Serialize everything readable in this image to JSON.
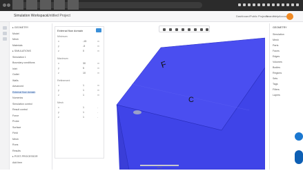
{
  "header": {
    "app_name": "Simulation Workspace",
    "project": "Untitled Project",
    "links": [
      "Dashboard",
      "Public Projects",
      "Search",
      "Help",
      "Account"
    ],
    "accent": "#f08a24"
  },
  "left_tree": {
    "items": [
      {
        "label": "▸ GEOMETRY",
        "sel": false
      },
      {
        "label": "  Model",
        "sel": false
      },
      {
        "label": "  Mesh",
        "sel": false
      },
      {
        "label": "  Materials",
        "sel": false
      },
      {
        "label": "▸ SIMULATIONS",
        "sel": false
      },
      {
        "label": "  Simulation 1",
        "sel": false
      },
      {
        "label": "  Boundary conditions",
        "sel": false
      },
      {
        "label": "  Inlet",
        "sel": false
      },
      {
        "label": "  Outlet",
        "sel": false
      },
      {
        "label": "  Walls",
        "sel": false
      },
      {
        "label": "  Advanced",
        "sel": false
      },
      {
        "label": "  External flow domain",
        "sel": true
      },
      {
        "label": "  Numerics",
        "sel": false
      },
      {
        "label": "  Simulation control",
        "sel": false
      },
      {
        "label": "  Result control",
        "sel": false
      },
      {
        "label": "  Force",
        "sel": false
      },
      {
        "label": "  Probe",
        "sel": false
      },
      {
        "label": "  Surface",
        "sel": false
      },
      {
        "label": "  Field",
        "sel": false
      },
      {
        "label": "  Mesh",
        "sel": false
      },
      {
        "label": "  Runs",
        "sel": false
      },
      {
        "label": "  Results",
        "sel": false
      },
      {
        "label": "▸ POST-PROCESSOR",
        "sel": false
      }
    ],
    "footer": "Add item"
  },
  "side_panel": {
    "title": "External flow domain",
    "sections": [
      {
        "label": "Minimum",
        "fields": [
          {
            "k": "x",
            "v": "-15",
            "u": "m"
          },
          {
            "k": "y",
            "v": "-5",
            "u": "m"
          },
          {
            "k": "z",
            "v": "0",
            "u": "m"
          }
        ]
      },
      {
        "label": "Maximum",
        "fields": [
          {
            "k": "x",
            "v": "30",
            "u": "m"
          },
          {
            "k": "y",
            "v": "5",
            "u": "m"
          },
          {
            "k": "z",
            "v": "10",
            "u": "m"
          }
        ]
      },
      {
        "label": "Refinement",
        "fields": [
          {
            "k": "x",
            "v": "1",
            "u": "m"
          },
          {
            "k": "y",
            "v": "1",
            "u": "m"
          },
          {
            "k": "z",
            "v": "1",
            "u": "m"
          }
        ]
      },
      {
        "label": "Mesh",
        "fields": [
          {
            "k": "x",
            "v": "1",
            "u": "-"
          },
          {
            "k": "y",
            "v": "1",
            "u": "-"
          },
          {
            "k": "z",
            "v": "1",
            "u": "-"
          }
        ]
      }
    ]
  },
  "viewport": {
    "face_label_top": "F",
    "face_label_side": "C",
    "box_fill": "#4a4ef0",
    "box_fill_side": "#3f44e8",
    "ruler_label": "10 m"
  },
  "right_panel": {
    "title": "GEOMETRY",
    "items": [
      "Simulation",
      "Mesh",
      "Parts",
      "Faces",
      "Edges",
      "Volumes",
      "Bodies",
      "Regions",
      "Sets",
      "Tags",
      "Filters",
      "Layers"
    ]
  }
}
